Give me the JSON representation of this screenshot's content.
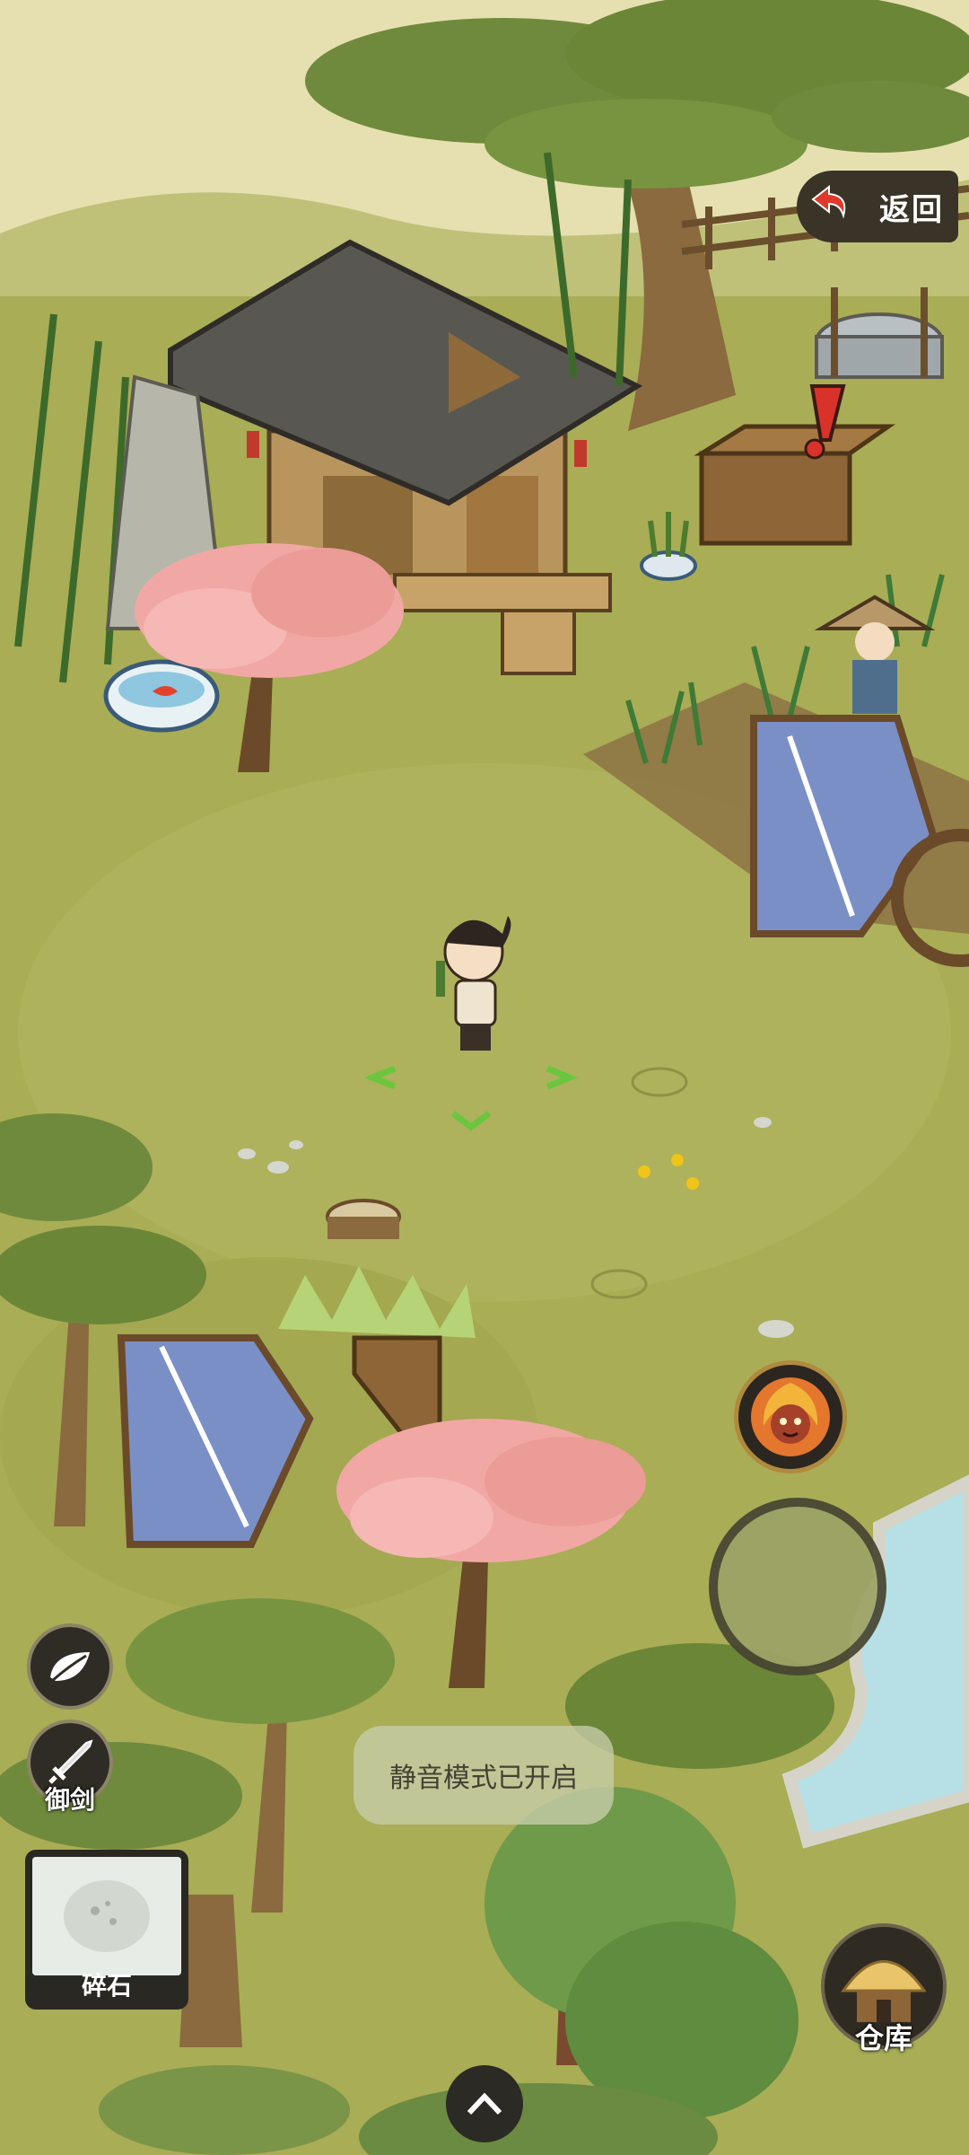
{
  "game": {
    "return_label": "返回",
    "sword_label": "御剑",
    "item_label": "碎石",
    "toast": "静音模式已开启",
    "warehouse_label": "仓库"
  },
  "colors": {
    "grass": "#a9ad55",
    "grass_light": "#b6b964",
    "sky": "#e8e2b4",
    "ui_dark": "#2f2c25",
    "cherry_blossom": "#f2a9a6"
  },
  "icons": {
    "return": "return-arrow-icon",
    "quest": "exclamation-icon",
    "leaf": "leaf-icon",
    "sword": "sword-icon",
    "skill": "fire-spirit-icon",
    "expand": "chevron-up-icon",
    "warehouse": "thatched-hut-icon"
  }
}
